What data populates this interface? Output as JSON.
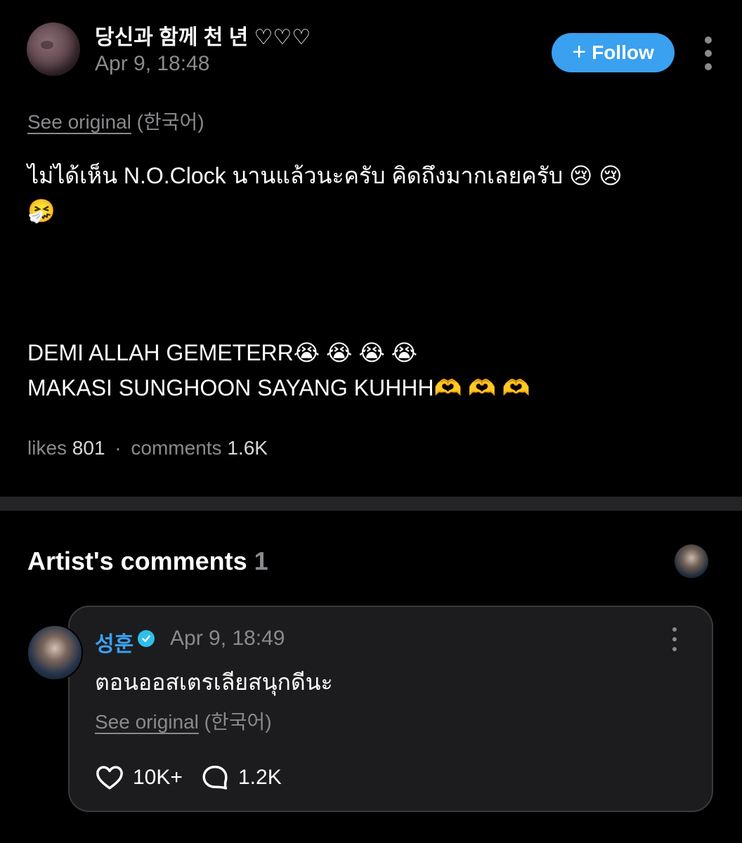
{
  "post": {
    "author": "당신과 함께 천 년 ♡♡♡",
    "time": "Apr 9, 18:48",
    "follow_label": "Follow",
    "follow_icon": "plus-icon",
    "more_icon": "more-vertical-icon",
    "see_original": "See original",
    "original_lang": "(한국어)",
    "line1": "ไม่ได้เห็น N.O.Clock นานแล้วนะครับ คิดถึงมากเลยครับ 😢 😢",
    "line2": "🤧",
    "line3": "DEMI ALLAH GEMETERR😭 😭 😭 😭",
    "line4": "MAKASI SUNGHOON SAYANG KUHHH🫶 🫶 🫶",
    "likes_label": "likes",
    "likes_value": "801",
    "separator": "·",
    "comments_label": "comments",
    "comments_value": "1.6K"
  },
  "artist_comments": {
    "title": "Artist's comments",
    "count": "1"
  },
  "comment": {
    "author": "성훈",
    "verified_icon": "verified-badge-icon",
    "time": "Apr 9, 18:49",
    "text": "ตอนออสเตรเลียสนุกดีนะ",
    "see_original": "See original",
    "original_lang": "(한국어)",
    "likes": "10K+",
    "replies": "1.2K"
  },
  "colors": {
    "background": "#000000",
    "accent": "#3aa0f0",
    "muted": "#8a8a8e",
    "card": "#1c1c1e"
  }
}
